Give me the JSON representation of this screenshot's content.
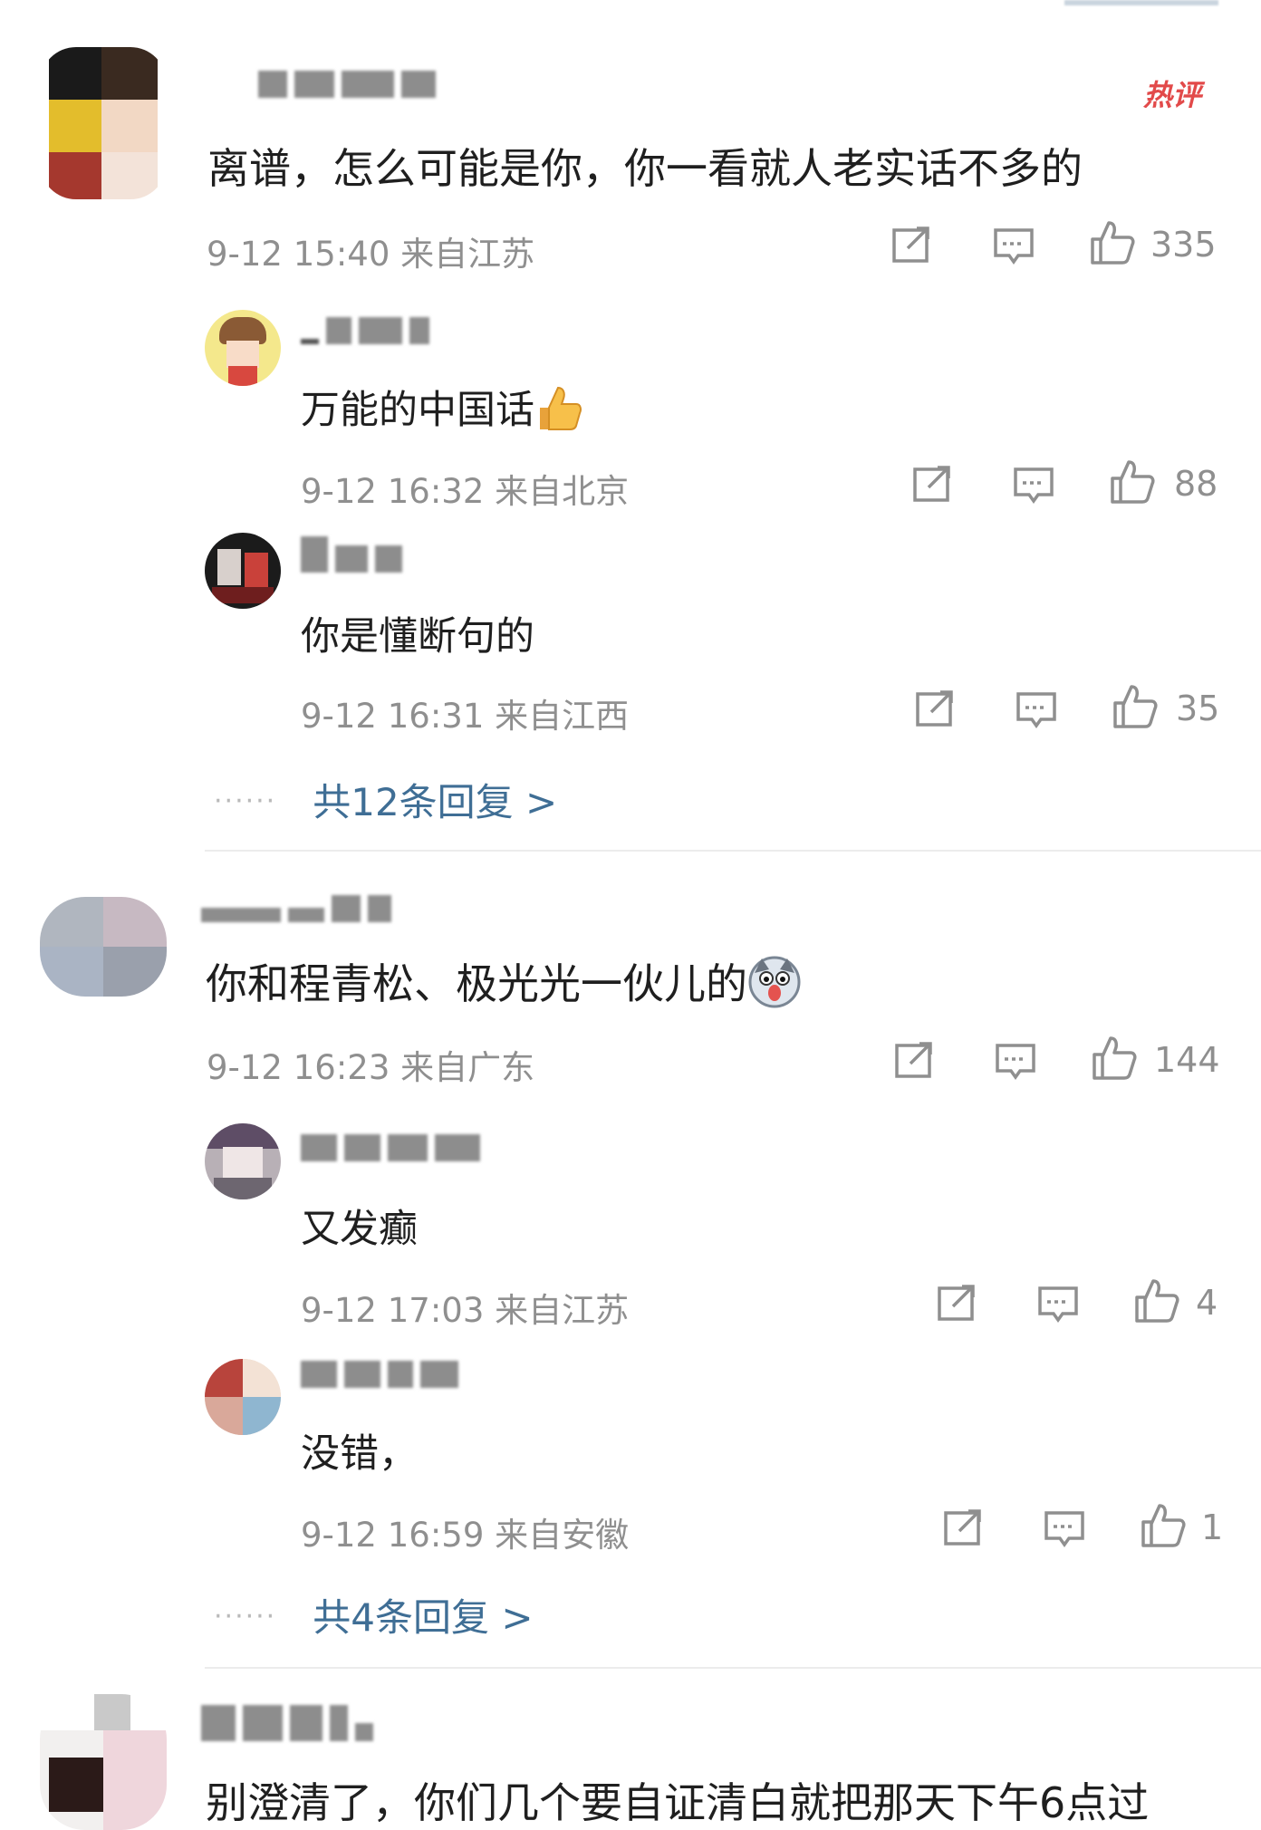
{
  "hot_badge": "热评",
  "more_arrow": ">",
  "comments": [
    {
      "text": "离谱，怎么可能是你，你一看就人老实话不多的",
      "meta": "9-12 15:40 来自江苏",
      "likes": "335",
      "replies": [
        {
          "text": "万能的中国话",
          "emoji": "thumbs-up-emoji",
          "meta": "9-12 16:32 来自北京",
          "likes": "88"
        },
        {
          "text": "你是懂断句的",
          "meta": "9-12 16:31 来自江西",
          "likes": "35"
        }
      ],
      "more_replies": "共12条回复"
    },
    {
      "text": "你和程青松、极光光一伙儿的",
      "emoji": "husky-emoji",
      "meta": "9-12 16:23 来自广东",
      "likes": "144",
      "replies": [
        {
          "text": "又发癫",
          "meta": "9-12 17:03 来自江苏",
          "likes": "4"
        },
        {
          "text": "没错，",
          "meta": "9-12 16:59 来自安徽",
          "likes": "1"
        }
      ],
      "more_replies": "共4条回复"
    },
    {
      "text": "别澄清了，你们几个要自证清白就把那天下午6点过"
    }
  ],
  "colors": {
    "link": "#3f6e95",
    "meta": "#8f8f8f",
    "hot": "#e24a4a",
    "text": "#1f1f1f"
  }
}
